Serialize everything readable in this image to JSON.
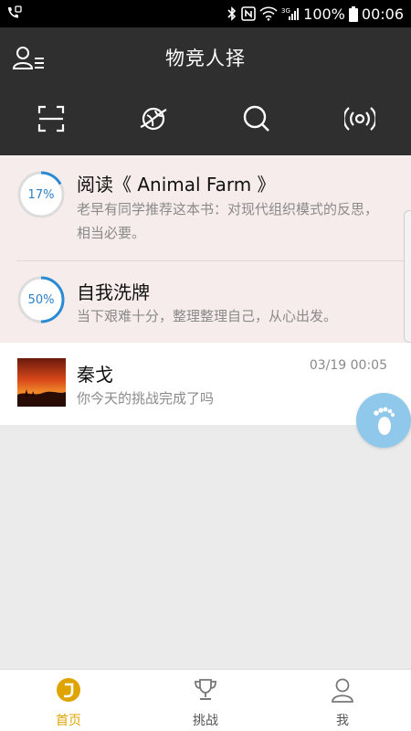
{
  "status_bar": {
    "battery": "100%",
    "time": "00:06",
    "network": "3G"
  },
  "header": {
    "title": "物竞人择",
    "icons": [
      "user-menu-icon",
      "scan-icon",
      "planet-icon",
      "search-icon",
      "broadcast-icon"
    ]
  },
  "tasks": [
    {
      "progress_label": "17%",
      "progress": 0.17,
      "title": "阅读《 Animal Farm 》",
      "description": "老早有同学推荐这本书：对现代组织模式的反思，相当必要。"
    },
    {
      "progress_label": "50%",
      "progress": 0.5,
      "title": "自我洗牌",
      "description": "当下艰难十分，整理整理自己，从心出发。"
    }
  ],
  "message": {
    "name": "秦戈",
    "text": "你今天的挑战完成了吗",
    "time": "03/19 00:05"
  },
  "tabs": [
    {
      "label": "首页",
      "active": true
    },
    {
      "label": "挑战",
      "active": false
    },
    {
      "label": "我",
      "active": false
    }
  ],
  "colors": {
    "header_bg": "#2f2f2f",
    "pink_card": "#f7ecec",
    "progress_blue": "#2a8ad4",
    "active_tab": "#e0a400",
    "fab": "#8fc8ea"
  }
}
